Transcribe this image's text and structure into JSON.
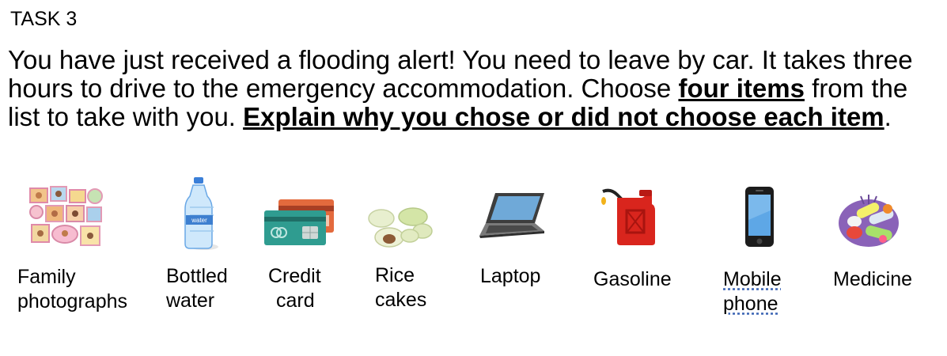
{
  "task": {
    "title": "TASK 3",
    "instructions": {
      "part1": "You have just received a flooding alert! You need to leave by car. It takes three hours to drive to the emergency accommodation. Choose ",
      "bold1": "four items",
      "part2": " from the list to take with you. ",
      "bold2": "Explain why you chose or did not choose each item",
      "part3": "."
    }
  },
  "items": [
    {
      "icon": "family-photos-icon",
      "label_line1": "Family",
      "label_line2": "photographs"
    },
    {
      "icon": "water-bottle-icon",
      "label_line1": "Bottled",
      "label_line2": "water",
      "bottle_text": "water"
    },
    {
      "icon": "credit-card-icon",
      "label_line1": "Credit",
      "label_line2": "card"
    },
    {
      "icon": "rice-cakes-icon",
      "label_line1": "Rice",
      "label_line2": "cakes"
    },
    {
      "icon": "laptop-icon",
      "label_line1": "Laptop"
    },
    {
      "icon": "gas-can-icon",
      "label_line1": "Gasoline"
    },
    {
      "icon": "mobile-phone-icon",
      "label_line1": "Mobile",
      "label_line2": "phone"
    },
    {
      "icon": "medicine-icon",
      "label_line1": "Medicine"
    }
  ]
}
